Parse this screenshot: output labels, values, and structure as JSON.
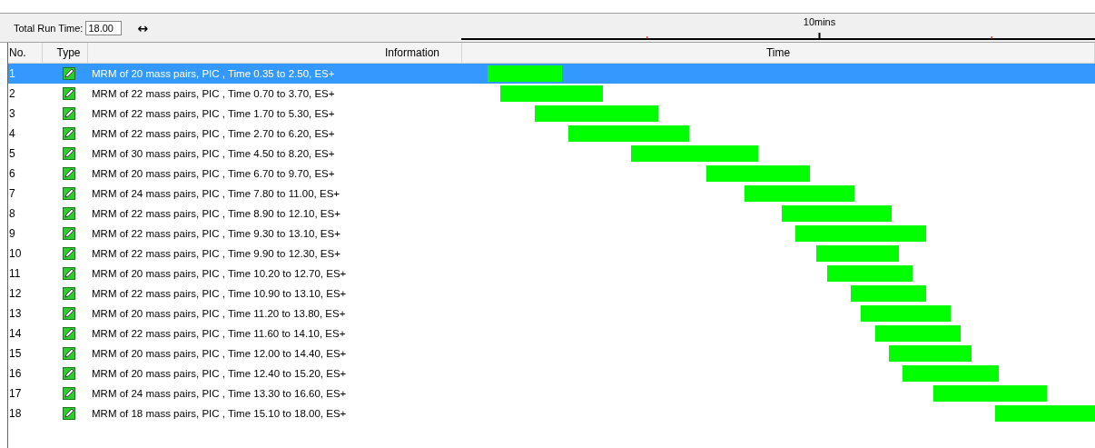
{
  "toolbar": {
    "run_time_label": "Total Run Time:",
    "run_time_value": "18.00",
    "arrow": "↔"
  },
  "table": {
    "columns": [
      "No.",
      "Type",
      "Information",
      "Time"
    ],
    "rows": [
      {
        "no": "1",
        "info": "MRM of 20 mass pairs, PIC , Time 0.35 to 2.50, ES+",
        "selected": true
      },
      {
        "no": "2",
        "info": "MRM of 22 mass pairs, PIC , Time 0.70 to 3.70, ES+",
        "selected": false
      },
      {
        "no": "3",
        "info": "MRM of 22 mass pairs, PIC , Time 1.70 to 5.30, ES+",
        "selected": false
      },
      {
        "no": "4",
        "info": "MRM of 22 mass pairs, PIC , Time 2.70 to 6.20, ES+",
        "selected": false
      },
      {
        "no": "5",
        "info": "MRM of 30 mass pairs, PIC , Time 4.50 to 8.20, ES+",
        "selected": false
      },
      {
        "no": "6",
        "info": "MRM of 20 mass pairs, PIC , Time 6.70 to 9.70, ES+",
        "selected": false
      },
      {
        "no": "7",
        "info": "MRM of 24 mass pairs, PIC , Time 7.80 to 11.00, ES+",
        "selected": false
      },
      {
        "no": "8",
        "info": "MRM of 22 mass pairs, PIC , Time 8.90 to 12.10, ES+",
        "selected": false
      },
      {
        "no": "9",
        "info": "MRM of 22 mass pairs, PIC , Time 9.30 to 13.10, ES+",
        "selected": false
      },
      {
        "no": "10",
        "info": "MRM of 22 mass pairs, PIC , Time 9.90 to 12.30, ES+",
        "selected": false
      },
      {
        "no": "11",
        "info": "MRM of 20 mass pairs, PIC , Time 10.20 to 12.70, ES+",
        "selected": false
      },
      {
        "no": "12",
        "info": "MRM of 22 mass pairs, PIC , Time 10.90 to 13.10, ES+",
        "selected": false
      },
      {
        "no": "13",
        "info": "MRM of 20 mass pairs, PIC , Time 11.20 to 13.80, ES+",
        "selected": false
      },
      {
        "no": "14",
        "info": "MRM of 22 mass pairs, PIC , Time 11.60 to 14.10, ES+",
        "selected": false
      },
      {
        "no": "15",
        "info": "MRM of 20 mass pairs, PIC , Time 12.00 to 14.40, ES+",
        "selected": false
      },
      {
        "no": "16",
        "info": "MRM of 20 mass pairs, PIC , Time 12.40 to 15.20, ES+",
        "selected": false
      },
      {
        "no": "17",
        "info": "MRM of 24 mass pairs, PIC , Time 13.30 to 16.60, ES+",
        "selected": false
      },
      {
        "no": "18",
        "info": "MRM of 18 mass pairs, PIC , Time 15.10 to 18.00, ES+",
        "selected": false
      }
    ]
  },
  "timeline": {
    "scale_label": "10mins"
  }
}
